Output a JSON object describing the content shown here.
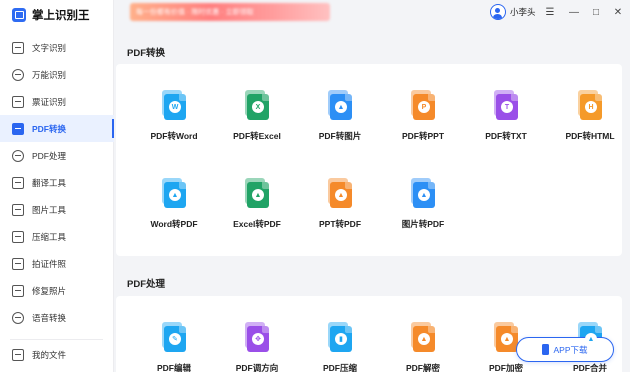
{
  "app": {
    "title": "掌上识别王"
  },
  "banner": {
    "text": "每一份都有价值 · 限时优惠 · 立即领取"
  },
  "user": {
    "name": "小李头"
  },
  "window_controls": {
    "menu": "☰",
    "minimize": "—",
    "maximize": "□",
    "close": "✕"
  },
  "sidebar": {
    "items": [
      {
        "label": "文字识别",
        "icon": "text-recognition-icon"
      },
      {
        "label": "万能识别",
        "icon": "camera-icon"
      },
      {
        "label": "票证识别",
        "icon": "ticket-icon"
      },
      {
        "label": "PDF转换",
        "icon": "pdf-convert-icon"
      },
      {
        "label": "PDF处理",
        "icon": "pdf-process-icon"
      },
      {
        "label": "翻译工具",
        "icon": "translate-icon"
      },
      {
        "label": "图片工具",
        "icon": "image-icon"
      },
      {
        "label": "压缩工具",
        "icon": "compress-icon"
      },
      {
        "label": "拍证件照",
        "icon": "id-photo-icon"
      },
      {
        "label": "修复照片",
        "icon": "photo-repair-icon"
      },
      {
        "label": "语音转换",
        "icon": "voice-icon"
      }
    ],
    "bottom": {
      "label": "我的文件",
      "icon": "folder-icon"
    }
  },
  "sections": {
    "pdf_convert": {
      "title": "PDF转换",
      "tools": [
        {
          "label": "PDF转Word",
          "color": "#1ea6f1",
          "glyph": "W",
          "glyph_color": "#1ea6f1"
        },
        {
          "label": "PDF转Excel",
          "color": "#21a366",
          "glyph": "X",
          "glyph_color": "#21a366"
        },
        {
          "label": "PDF转图片",
          "color": "#2c8ff5",
          "glyph": "▲",
          "glyph_color": "#2c8ff5"
        },
        {
          "label": "PDF转PPT",
          "color": "#f58a2a",
          "glyph": "P",
          "glyph_color": "#f58a2a"
        },
        {
          "label": "PDF转TXT",
          "color": "#9a4fe8",
          "glyph": "T",
          "glyph_color": "#9a4fe8"
        },
        {
          "label": "PDF转HTML",
          "color": "#f59a2a",
          "glyph": "H",
          "glyph_color": "#f59a2a"
        },
        {
          "label": "Word转PDF",
          "color": "#1ea6f1",
          "glyph": "▲",
          "glyph_color": "#1ea6f1"
        },
        {
          "label": "Excel转PDF",
          "color": "#21a366",
          "glyph": "▲",
          "glyph_color": "#21a366"
        },
        {
          "label": "PPT转PDF",
          "color": "#f58a2a",
          "glyph": "▲",
          "glyph_color": "#f58a2a"
        },
        {
          "label": "图片转PDF",
          "color": "#2c8ff5",
          "glyph": "▲",
          "glyph_color": "#2c8ff5"
        }
      ]
    },
    "pdf_process": {
      "title": "PDF处理",
      "tools": [
        {
          "label": "PDF编辑",
          "color": "#1ea6f1",
          "glyph": "✎",
          "glyph_color": "#1ea6f1"
        },
        {
          "label": "PDF调方向",
          "color": "#9a4fe8",
          "glyph": "✥",
          "glyph_color": "#9a4fe8"
        },
        {
          "label": "PDF压缩",
          "color": "#1ea6f1",
          "glyph": "▮",
          "glyph_color": "#1ea6f1"
        },
        {
          "label": "PDF解密",
          "color": "#f58a2a",
          "glyph": "▲",
          "glyph_color": "#f58a2a"
        },
        {
          "label": "PDF加密",
          "color": "#f58a2a",
          "glyph": "▲",
          "glyph_color": "#f58a2a"
        },
        {
          "label": "PDF合并",
          "color": "#1ea6f1",
          "glyph": "▲",
          "glyph_color": "#1ea6f1"
        }
      ]
    }
  },
  "app_download": {
    "label": "APP下载"
  }
}
